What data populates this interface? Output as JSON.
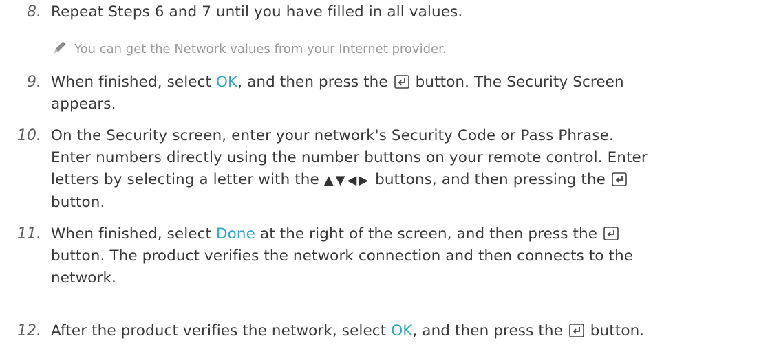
{
  "steps": [
    {
      "number": "8.",
      "text": "Repeat Steps 6 and 7 until you have filled in all values."
    },
    {
      "note": "You can get the Network values from your Internet provider."
    },
    {
      "number": "9.",
      "t1": "When finished, select",
      "hl": "OK",
      "t2": ", and then press the",
      "t3": "button. The Security Screen",
      "t4": "appears."
    },
    {
      "number": "10.",
      "line1": "On the Security screen, enter your network's Security Code or Pass Phrase.",
      "line2": "Enter numbers directly using the number buttons on your remote control. Enter",
      "line3a": "letters by selecting a letter with the",
      "arrows": "▲▼◀▶",
      "line3b": "buttons, and then pressing the",
      "line4": "button."
    },
    {
      "number": "11.",
      "t1": "When finished, select",
      "hl": "Done",
      "t2": "at the right of the screen, and then press the",
      "line2": "button. The product verifies the network connection and then connects to the",
      "line3": "network."
    },
    {
      "number": "12.",
      "t1": "After the product verifies the network, select",
      "hl": "OK",
      "t2": ", and then press the",
      "t3": "button."
    }
  ],
  "colors": {
    "highlight": "#2ea7c4",
    "body_text": "#3a3a3a",
    "note_text": "#9a9a9a"
  },
  "icons": [
    "pencil-note-icon",
    "enter-button-icon",
    "directional-arrows"
  ]
}
